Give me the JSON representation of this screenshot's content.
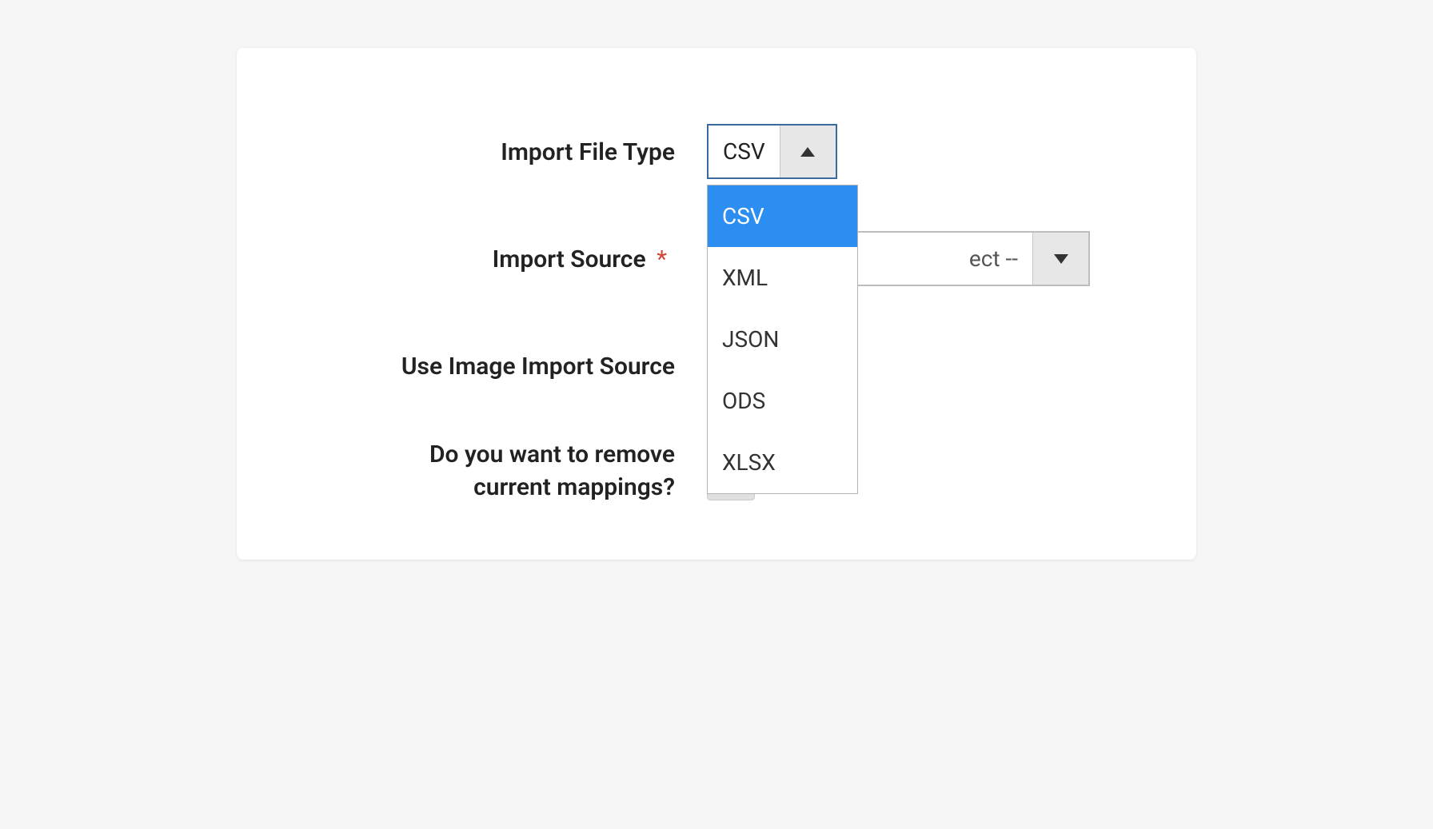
{
  "labels": {
    "import_file_type": "Import File Type",
    "import_source": "Import Source",
    "use_image_import_source": "Use Image Import Source",
    "remove_mappings_line1": "Do you want to remove",
    "remove_mappings_line2": "current mappings?"
  },
  "required_asterisk": "*",
  "file_type_select": {
    "value": "CSV",
    "options": [
      "CSV",
      "XML",
      "JSON",
      "ODS",
      "XLSX"
    ]
  },
  "import_source_select": {
    "value": "-- Please Select --",
    "visible_fragment": "ect --"
  }
}
